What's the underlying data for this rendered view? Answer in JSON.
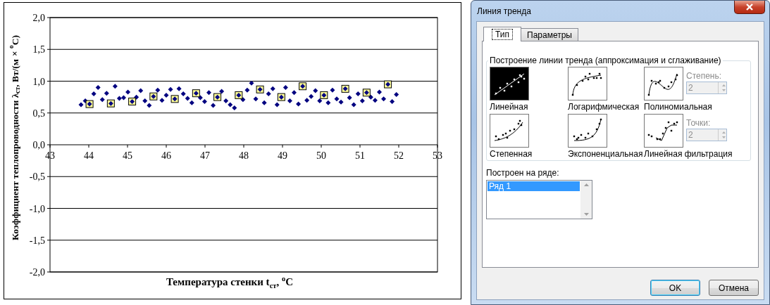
{
  "chart": {
    "series_selected": true,
    "chart_data": {
      "type": "scatter",
      "grid": true,
      "xlabel": "Температура стенки t$_{ст}$, $^{о}$С",
      "ylabel": "Коэффициент теплопроводности λ$_{ст}$, Вт/(м×$^{о}$С)",
      "xlim": [
        43,
        53
      ],
      "ylim": [
        -2,
        2
      ],
      "xticks": [
        43,
        44,
        45,
        46,
        47,
        48,
        49,
        50,
        51,
        52,
        53
      ],
      "yticks": [
        {
          "value": 2,
          "label": "2,0"
        },
        {
          "value": 1.5,
          "label": "1,5"
        },
        {
          "value": 1,
          "label": "1,0"
        },
        {
          "value": 0.5,
          "label": "0,5"
        },
        {
          "value": 0,
          "label": "0,0"
        },
        {
          "value": -0.5,
          "label": "-0,5"
        },
        {
          "value": -1,
          "label": "-1,0"
        },
        {
          "value": -1.5,
          "label": "-1,5"
        },
        {
          "value": -2,
          "label": "-2,0"
        }
      ],
      "x": [
        43.8,
        43.91,
        44.02,
        44.13,
        44.24,
        44.35,
        44.46,
        44.57,
        44.68,
        44.79,
        44.9,
        45.01,
        45.12,
        45.23,
        45.34,
        45.45,
        45.56,
        45.67,
        45.78,
        45.89,
        46,
        46.11,
        46.22,
        46.33,
        46.44,
        46.55,
        46.66,
        46.77,
        46.88,
        46.99,
        47.1,
        47.21,
        47.32,
        47.43,
        47.54,
        47.65,
        47.76,
        47.87,
        47.98,
        48.09,
        48.2,
        48.31,
        48.42,
        48.53,
        48.64,
        48.75,
        48.86,
        48.97,
        49.08,
        49.19,
        49.3,
        49.41,
        49.52,
        49.63,
        49.74,
        49.85,
        49.96,
        50.07,
        50.18,
        50.29,
        50.4,
        50.51,
        50.62,
        50.73,
        50.84,
        50.95,
        51.06,
        51.17,
        51.28,
        51.39,
        51.5,
        51.61,
        51.72,
        51.83,
        51.94
      ],
      "series": [
        {
          "color": "#000080",
          "values": [
            0.63,
            0.69,
            0.64,
            0.8,
            0.9,
            0.71,
            0.81,
            0.65,
            0.92,
            0.73,
            0.74,
            0.83,
            0.68,
            0.75,
            0.85,
            0.69,
            0.62,
            0.76,
            0.86,
            0.7,
            0.78,
            0.87,
            0.72,
            0.88,
            0.8,
            0.73,
            0.66,
            0.81,
            0.74,
            0.68,
            0.82,
            0.62,
            0.75,
            0.84,
            0.69,
            0.63,
            0.58,
            0.78,
            0.71,
            0.86,
            0.97,
            0.72,
            0.87,
            0.66,
            0.8,
            0.88,
            0.63,
            0.75,
            0.9,
            0.69,
            0.82,
            0.64,
            0.92,
            0.7,
            0.76,
            0.85,
            0.69,
            0.78,
            0.66,
            0.86,
            0.72,
            0.67,
            0.88,
            0.74,
            0.63,
            0.8,
            0.69,
            0.82,
            0.75,
            0.7,
            0.83,
            0.72,
            0.95,
            0.68,
            0.79
          ]
        }
      ]
    }
  },
  "dialog": {
    "title": "Линия тренда",
    "tabs": [
      {
        "label": "Тип",
        "selected": true
      },
      {
        "label": "Параметры",
        "selected": false
      }
    ],
    "group_title": "Построение линии тренда (аппроксимация и сглаживание)",
    "types": [
      {
        "kind": "linear",
        "label": "Линейная",
        "selected": true
      },
      {
        "kind": "log",
        "label": "Логарифмическая",
        "selected": false
      },
      {
        "kind": "poly",
        "label": "Полиномиальная",
        "selected": false,
        "spinner": {
          "label": "Степень:",
          "value": "2",
          "disabled": true
        }
      },
      {
        "kind": "power",
        "label": "Степенная",
        "selected": false
      },
      {
        "kind": "exp",
        "label": "Экспоненциальная",
        "selected": false
      },
      {
        "kind": "moving",
        "label": "Линейная фильтрация",
        "selected": false,
        "spinner": {
          "label": "Точки:",
          "value": "2",
          "disabled": true
        }
      }
    ],
    "series_list": {
      "label": "Построен на ряде:",
      "items": [
        {
          "label": "Ряд 1",
          "selected": true
        }
      ]
    },
    "buttons": [
      {
        "label": "OK",
        "default": true
      },
      {
        "label": "Отмена",
        "default": false
      }
    ]
  }
}
